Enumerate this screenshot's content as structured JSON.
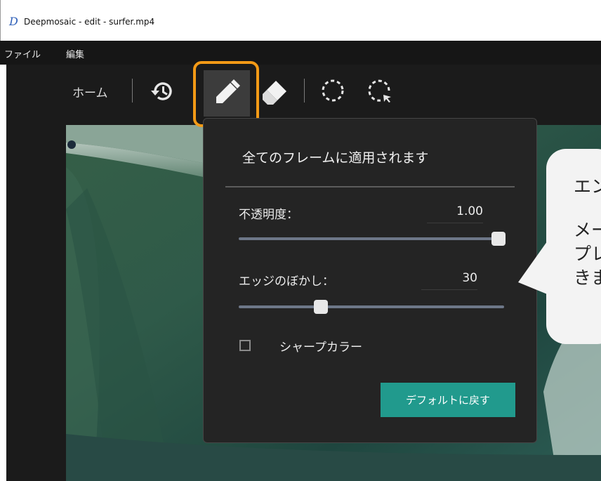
{
  "window": {
    "logo_letter": "D",
    "title": "Deepmosaic - edit - surfer.mp4"
  },
  "menu": {
    "items": [
      "ファイル",
      "編集"
    ]
  },
  "toolbar": {
    "home_label": "ホーム",
    "tools": [
      "history-icon",
      "pen-icon",
      "eraser-icon",
      "circle-select-icon",
      "circle-select-cursor-icon"
    ],
    "selected_tool": "pen-icon",
    "highlight_color": "#f39a16"
  },
  "popup": {
    "title": "全てのフレームに適用されます",
    "opacity": {
      "label": "不透明度：",
      "value": "1.00",
      "level": 1.0
    },
    "edge_blur": {
      "label": "エッジのぼかし：",
      "value": "30",
      "level": 0.3
    },
    "sharp_color": {
      "label": "シャープカラー",
      "checked": false
    },
    "reset_label": "デフォルトに戻す",
    "reset_color": "#219a8d"
  },
  "callout": {
    "lines": [
      "エン",
      "メー",
      "プレ",
      "きま"
    ]
  }
}
